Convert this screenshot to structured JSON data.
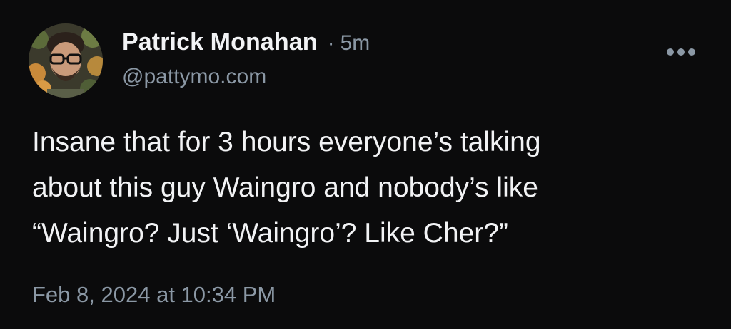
{
  "post": {
    "author": {
      "display_name": "Patrick Monahan",
      "handle": "@pattymo.com",
      "avatar_icon": "avatar-illustrated-portrait"
    },
    "separator": "·",
    "relative_time": "5m",
    "more_icon": "more-horizontal-icon",
    "text_lines": [
      "Insane that for 3 hours everyone’s talking",
      "about this guy Waingro and nobody’s like",
      "“Waingro? Just ‘Waingro’? Like Cher?”"
    ],
    "full_date": "Feb 8, 2024 at 10:34 PM"
  },
  "colors": {
    "background": "#0b0b0c",
    "primary_text": "#f2f3f5",
    "secondary_text": "#8b98a5"
  }
}
